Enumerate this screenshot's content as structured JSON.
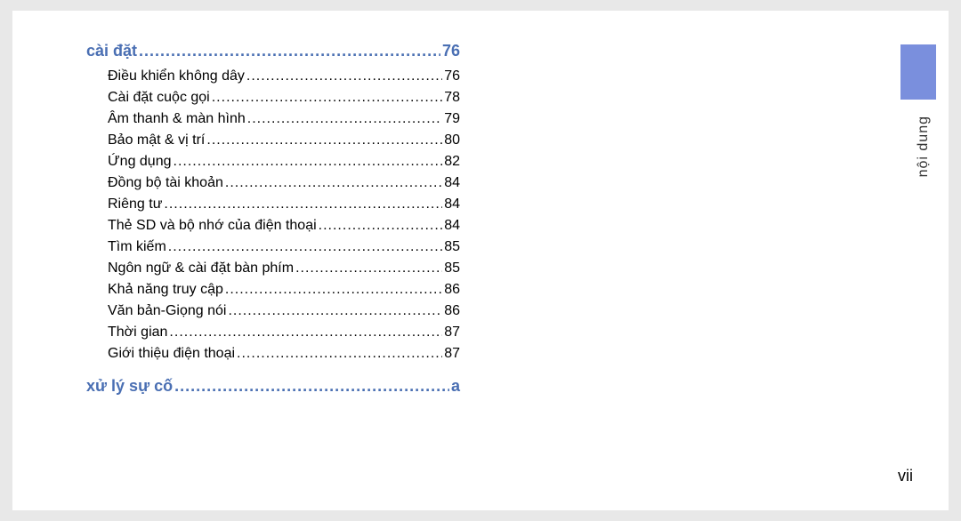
{
  "sections": [
    {
      "title": "cài đặt",
      "page": "76",
      "items": [
        {
          "title": "Điều khiển không dây",
          "page": "76"
        },
        {
          "title": "Cài đặt cuộc gọi",
          "page": "78"
        },
        {
          "title": "Âm thanh & màn hình",
          "page": "79"
        },
        {
          "title": "Bảo mật & vị trí",
          "page": "80"
        },
        {
          "title": "Ứng dụng",
          "page": "82"
        },
        {
          "title": "Đồng bộ tài khoản",
          "page": "84"
        },
        {
          "title": "Riêng tư",
          "page": "84"
        },
        {
          "title": "Thẻ SD và bộ nhớ của điện thoại",
          "page": "84"
        },
        {
          "title": "Tìm kiếm",
          "page": "85"
        },
        {
          "title": "Ngôn ngữ & cài đặt bàn phím",
          "page": "85"
        },
        {
          "title": "Khả năng truy cập",
          "page": "86"
        },
        {
          "title": "Văn bản-Giọng nói",
          "page": "86"
        },
        {
          "title": "Thời gian",
          "page": "87"
        },
        {
          "title": "Giới thiệu điện thoại",
          "page": "87"
        }
      ]
    },
    {
      "title": "xử lý sự cố",
      "page": "a",
      "items": []
    }
  ],
  "sideLabel": "nội dung",
  "pageNumber": "vii",
  "leaderDots": "........................................................................................"
}
